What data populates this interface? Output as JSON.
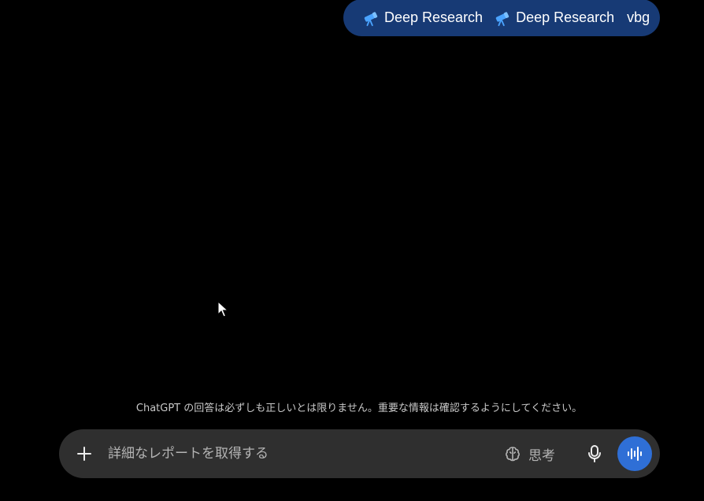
{
  "message": {
    "chips": [
      {
        "label": "Deep Research",
        "icon": "telescope-icon"
      },
      {
        "label": "Deep Research",
        "icon": "telescope-icon"
      }
    ],
    "suffix": "vbg",
    "bubble_color": "#173a75"
  },
  "disclaimer": "ChatGPT の回答は必ずしも正しいとは限りません。重要な情報は確認するようにしてください。",
  "composer": {
    "placeholder": "詳細なレポートを取得する",
    "value": "",
    "think_label": "思考",
    "voice_button_color": "#2f6fd6",
    "icons": {
      "add": "plus-icon",
      "think": "brain-icon",
      "mic": "microphone-icon",
      "voice": "voice-waveform-icon"
    }
  }
}
